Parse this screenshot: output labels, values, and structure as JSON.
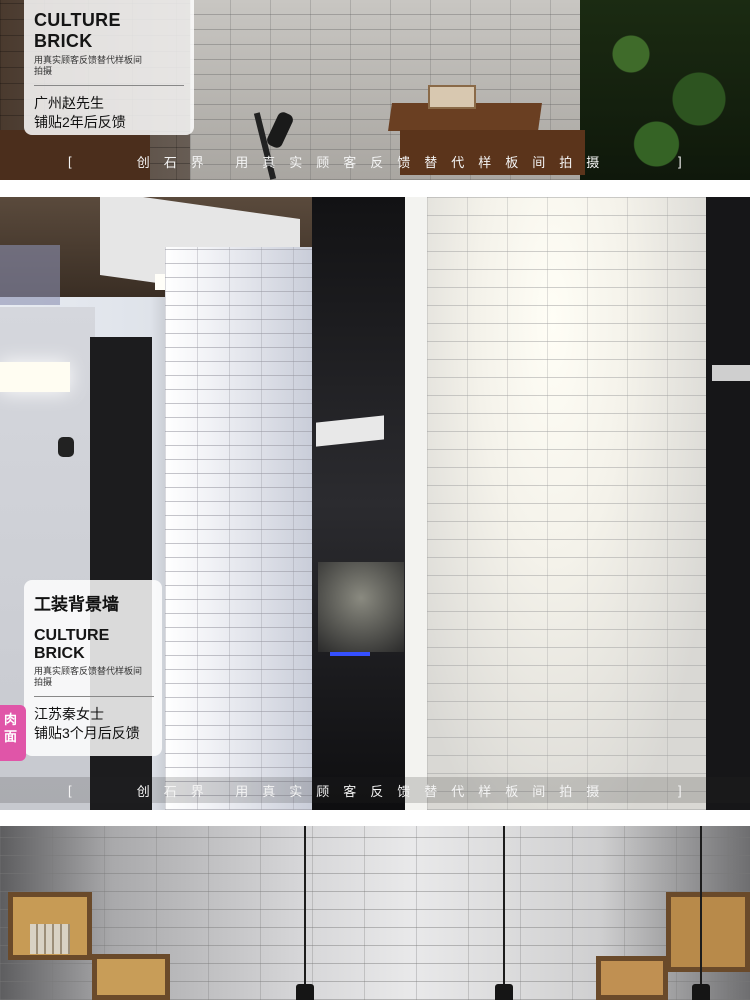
{
  "panel1": {
    "card": {
      "title": "CULTURE BRICK",
      "subtitle": "用真实顾客反馈替代样板间拍摄",
      "person": "广州赵先生",
      "note": "铺贴2年后反馈"
    },
    "caption": {
      "open": "[",
      "text": "创石界 用真实顾客反馈替代样板间拍摄",
      "close": "]"
    }
  },
  "panel2": {
    "card": {
      "heading": "工装背景墙",
      "title": "CULTURE BRICK",
      "subtitle": "用真实顾客反馈替代样板间拍摄",
      "person": "江苏秦女士",
      "note": "铺贴3个月后反馈"
    },
    "side_badge": "肉面",
    "caption": {
      "open": "[",
      "text": "创石界 用真实顾客反馈替代样板间拍摄",
      "close": "]"
    }
  },
  "icons": [
    "camera-icon",
    "pendant-lamp-icon"
  ]
}
